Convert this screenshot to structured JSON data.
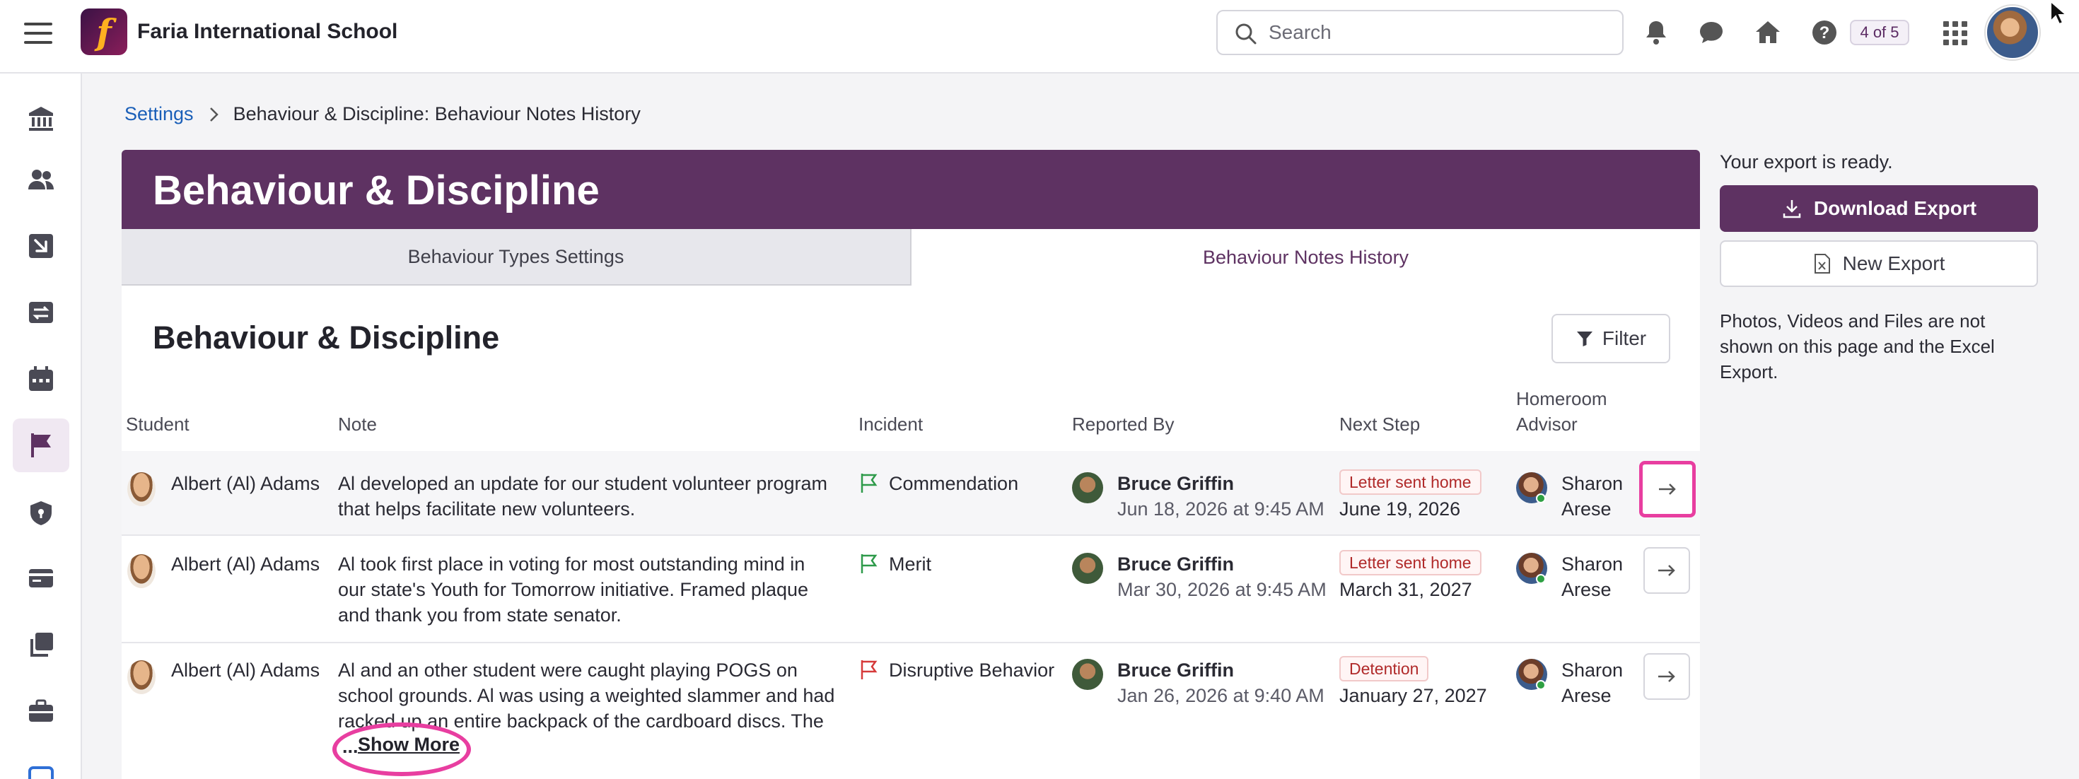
{
  "header": {
    "school_name": "Faria International School",
    "logo_letter": "f",
    "search_placeholder": "Search",
    "page_count": "4 of 5"
  },
  "sidebar": {
    "items": [
      "bank-icon",
      "people-icon",
      "arrow-down-right-icon",
      "transfer-icon",
      "calendar-icon",
      "flag-icon",
      "shield-icon",
      "id-card-icon",
      "copy-icon",
      "briefcase-icon"
    ],
    "active": "flag-icon"
  },
  "breadcrumb": {
    "parent": "Settings",
    "current": "Behaviour & Discipline: Behaviour Notes History"
  },
  "banner": {
    "title": "Behaviour & Discipline"
  },
  "tabs": [
    {
      "label": "Behaviour Types Settings",
      "active": false
    },
    {
      "label": "Behaviour Notes History",
      "active": true
    }
  ],
  "section": {
    "title": "Behaviour & Discipline",
    "filter_label": "Filter"
  },
  "table": {
    "columns": {
      "student": "Student",
      "note": "Note",
      "incident": "Incident",
      "reported_by": "Reported By",
      "next_step": "Next Step",
      "advisor_line1": "Homeroom",
      "advisor_line2": "Advisor"
    },
    "rows": [
      {
        "student": "Albert (Al) Adams",
        "note": [
          "Al developed an update for our student volunteer program",
          "that helps facilitate new volunteers."
        ],
        "incident": "Commendation",
        "flag_color": "#2e9a4a",
        "reporter": "Bruce Griffin",
        "reported_date": "Jun 18, 2026 at 9:45 AM",
        "next_step_badge": "Letter sent home",
        "next_step_date": "June 19, 2026",
        "advisor_first": "Sharon",
        "advisor_last": "Arese"
      },
      {
        "student": "Albert (Al) Adams",
        "note": [
          "Al took first place in voting for most outstanding mind in",
          "our state's Youth for Tomorrow initiative. Framed plaque",
          "and thank you from state senator."
        ],
        "incident": "Merit",
        "flag_color": "#2e9a4a",
        "reporter": "Bruce Griffin",
        "reported_date": "Mar 30, 2026 at 9:45 AM",
        "next_step_badge": "Letter sent home",
        "next_step_date": "March 31, 2027",
        "advisor_first": "Sharon",
        "advisor_last": "Arese"
      },
      {
        "student": "Albert (Al) Adams",
        "note": [
          "Al and an other student were caught playing POGS on",
          "school grounds. Al was using a weighted slammer and had",
          "racked up an entire backpack of the cardboard discs. The"
        ],
        "show_more_prefix": "...",
        "show_more": "Show More",
        "incident": "Disruptive Behavior",
        "flag_color": "#d63a3a",
        "reporter": "Bruce Griffin",
        "reported_date": "Jan 26, 2026 at 9:40 AM",
        "next_step_badge": "Detention",
        "next_step_date": "January 27, 2027",
        "advisor_first": "Sharon",
        "advisor_last": "Arese"
      }
    ]
  },
  "export_panel": {
    "ready_text": "Your export is ready.",
    "download_label": "Download Export",
    "new_label": "New Export",
    "note": "Photos, Videos and Files are not shown on this page and the Excel Export."
  },
  "colors": {
    "brand_purple": "#5e3262",
    "highlight_pink": "#e83ea0",
    "link_blue": "#1a5fb8",
    "badge_red": "#b02a2a"
  }
}
